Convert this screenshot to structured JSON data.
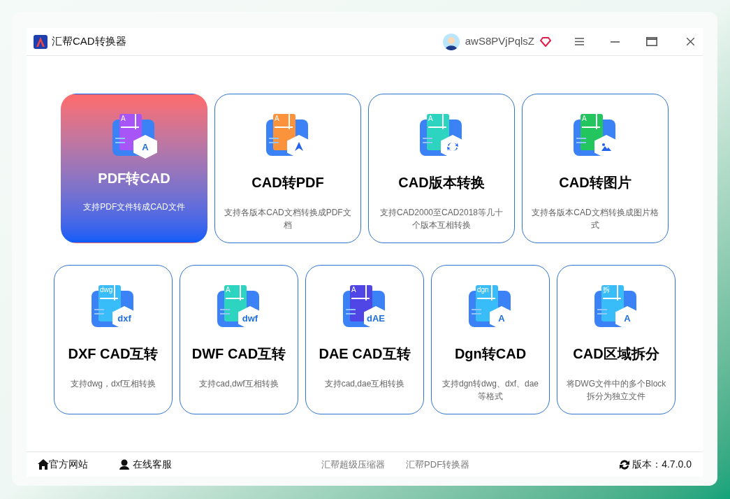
{
  "window": {
    "title": "汇帮CAD转换器",
    "user": "awS8PVjPqlsZ"
  },
  "rows": [
    [
      {
        "title": "PDF转CAD",
        "desc": "支持PDF文件转成CAD文件",
        "selected": true,
        "icon": {
          "color": "#a855f7",
          "tab_text": "A",
          "badge": "A",
          "kind": "text"
        }
      },
      {
        "title": "CAD转PDF",
        "desc": "支持各版本CAD文档转换成PDF文档",
        "selected": false,
        "icon": {
          "color": "#fb923c",
          "tab_text": "A",
          "kind": "pen"
        }
      },
      {
        "title": "CAD版本转换",
        "desc": "支持CAD2000至CAD2018等几十个版本互相转换",
        "selected": false,
        "icon": {
          "color": "#2dd4bf",
          "tab_text": "A",
          "kind": "arrows"
        }
      },
      {
        "title": "CAD转图片",
        "desc": "支持各版本CAD文档转换成图片格式",
        "selected": false,
        "icon": {
          "color": "#22c55e",
          "tab_text": "A",
          "kind": "image"
        }
      }
    ],
    [
      {
        "title": "DXF CAD互转",
        "desc": "支持dwg，dxf互相转换",
        "selected": false,
        "icon": {
          "color": "#38bdf8",
          "tab_text": "dwg",
          "badge": "dxf",
          "kind": "text"
        }
      },
      {
        "title": "DWF CAD互转",
        "desc": "支持cad,dwf互相转换",
        "selected": false,
        "icon": {
          "color": "#2dd4bf",
          "tab_text": "A",
          "badge": "dwf",
          "kind": "text"
        }
      },
      {
        "title": "DAE CAD互转",
        "desc": "支持cad,dae互相转换",
        "selected": false,
        "icon": {
          "color": "#4f46e5",
          "tab_text": "A",
          "badge": "dAE",
          "kind": "text"
        }
      },
      {
        "title": "Dgn转CAD",
        "desc": "支持dgn转dwg、dxf、dae等格式",
        "selected": false,
        "icon": {
          "color": "#38bdf8",
          "tab_text": "dgn",
          "badge": "A",
          "kind": "text"
        }
      },
      {
        "title": "CAD区域拆分",
        "desc": "将DWG文件中的多个Block拆分为独立文件",
        "selected": false,
        "icon": {
          "color": "#38bdf8",
          "tab_text": "拆",
          "badge": "A",
          "kind": "text"
        }
      }
    ]
  ],
  "footer": {
    "left": [
      {
        "kind": "home",
        "label": "官方网站"
      },
      {
        "kind": "support",
        "label": "在线客服"
      }
    ],
    "links": [
      "汇帮超级压缩器",
      "汇帮PDF转换器"
    ],
    "version": "版本：4.7.0.0"
  }
}
